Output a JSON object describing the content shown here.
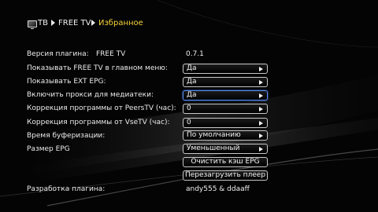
{
  "breadcrumb": {
    "items": [
      "ТВ",
      "FREE TV",
      "Избранное"
    ],
    "active_color": "#f5d33a"
  },
  "plugin": {
    "version_label": "Версия плагина:",
    "name": "FREE TV",
    "version": "0.7.1",
    "author_label": "Разработка плагина:",
    "author": "andy555 & ddaaff"
  },
  "settings": [
    {
      "label": "Показывать FREE TV в главном меню:",
      "value": "Да"
    },
    {
      "label": "Показывать EXT EPG:",
      "value": "Да"
    },
    {
      "label": "Включить прокси для медиатеки:",
      "value": "Да"
    },
    {
      "label": "Коррекция программы от PeersTV (час):",
      "value": "0"
    },
    {
      "label": "Коррекция программы от VseTV (час):",
      "value": "0"
    },
    {
      "label": "Время буферизации:",
      "value": "По умолчанию"
    },
    {
      "label": "Размер EPG",
      "value": "Уменьшенный"
    }
  ],
  "actions": {
    "clear_cache": "Очистить кэш EPG",
    "restart_player": "Перезагрузить плеер"
  },
  "colors": {
    "focus_border": "#5b8ef0",
    "background": "#050505"
  }
}
